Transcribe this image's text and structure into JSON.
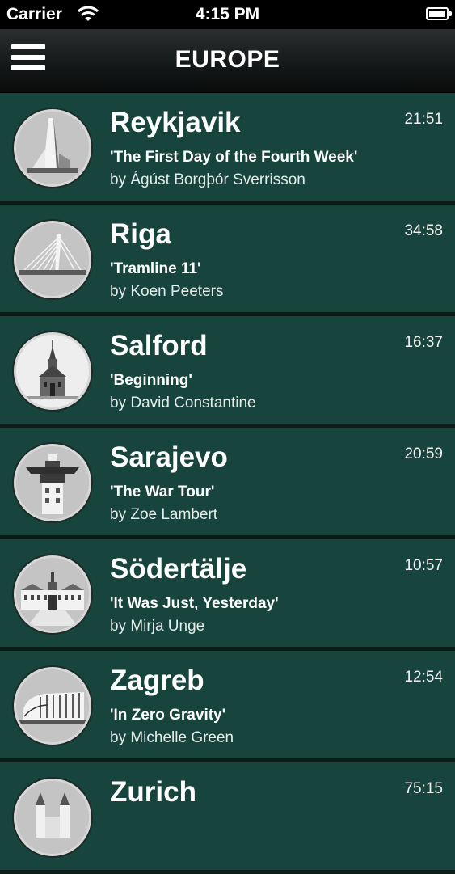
{
  "status_bar": {
    "carrier": "Carrier",
    "time": "4:15 PM",
    "wifi_icon": "wifi-icon",
    "battery_icon": "battery-icon"
  },
  "nav": {
    "title": "EUROPE",
    "menu_icon": "hamburger-menu-icon"
  },
  "colors": {
    "row_background": "#17443c",
    "row_separator": "#0b1d19",
    "nav_background": "#141717"
  },
  "stories": [
    {
      "city": "Reykjavik",
      "title": "'The First Day of the Fourth Week'",
      "author": "by Ágúst Borgþór Sverrisson",
      "duration": "21:51",
      "icon": "church-tower-icon"
    },
    {
      "city": "Riga",
      "title": "'Tramline 11'",
      "author": "by Koen Peeters",
      "duration": "34:58",
      "icon": "cable-bridge-icon"
    },
    {
      "city": "Salford",
      "title": "'Beginning'",
      "author": "by David Constantine",
      "duration": "16:37",
      "icon": "chapel-icon"
    },
    {
      "city": "Sarajevo",
      "title": "'The War Tour'",
      "author": "by Zoe Lambert",
      "duration": "20:59",
      "icon": "tower-icon"
    },
    {
      "city": "Södertälje",
      "title": "'It Was Just, Yesterday'",
      "author": "by Mirja Unge",
      "duration": "10:57",
      "icon": "palace-icon"
    },
    {
      "city": "Zagreb",
      "title": "'In Zero Gravity'",
      "author": "by Michelle Green",
      "duration": "12:54",
      "icon": "arena-icon"
    },
    {
      "city": "Zurich",
      "title": "",
      "author": "",
      "duration": "75:15",
      "icon": "cathedral-icon"
    }
  ]
}
